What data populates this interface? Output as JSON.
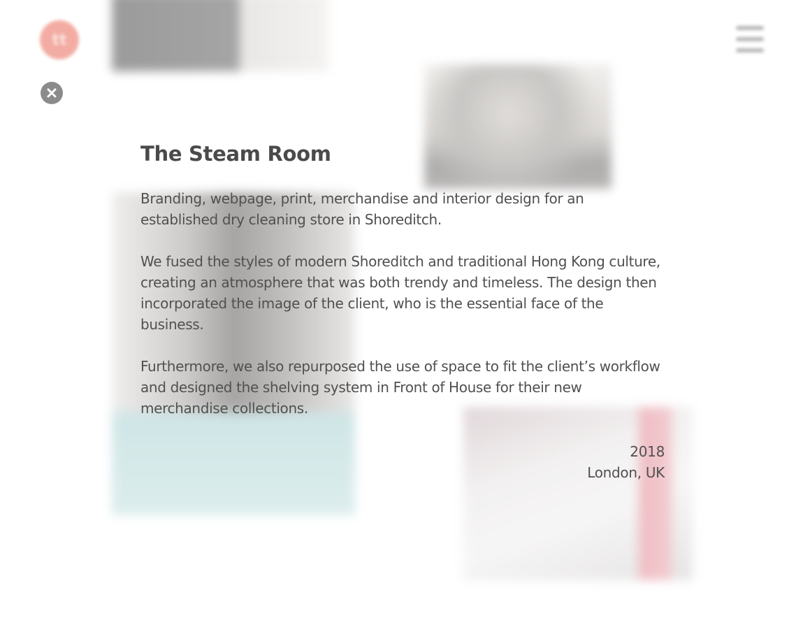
{
  "header": {
    "logo_text": "tt",
    "close_icon": "close-icon",
    "menu_icon": "hamburger-menu-icon"
  },
  "project": {
    "title": "The Steam Room",
    "paragraphs": [
      "Branding, webpage, print, merchandise and interior design for an established dry cleaning store in Shoreditch.",
      "We fused the styles of modern Shoreditch and traditional Hong Kong culture, creating an atmosphere that was both trendy and timeless. The design then incorporated the image of the client, who is the essential face of the business.",
      "Furthermore, we also repurposed the use of space to fit the client’s workflow and designed the shelving system in Front of House for their new merchandise collections."
    ],
    "year": "2018",
    "location": "London, UK"
  },
  "colors": {
    "accent": "#f2a49a",
    "text": "#4b4b4b",
    "close_button": "#8b8b8b"
  }
}
